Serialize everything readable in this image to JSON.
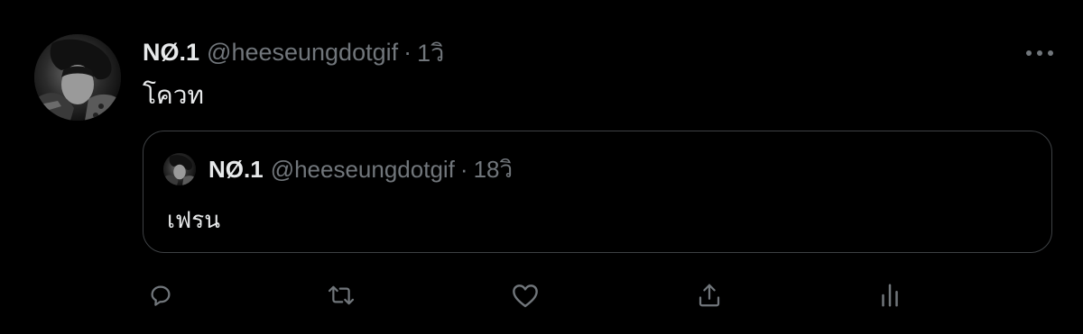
{
  "tweet": {
    "display_name": "NØ.1",
    "handle": "@heeseungdotgif",
    "separator": "·",
    "time": "1วิ",
    "text": "โควท"
  },
  "quoted_tweet": {
    "display_name": "NØ.1",
    "handle": "@heeseungdotgif",
    "separator": "·",
    "time": "18วิ",
    "text": "เฟรน"
  },
  "actions": [
    {
      "name": "reply-icon"
    },
    {
      "name": "retweet-icon"
    },
    {
      "name": "like-icon"
    },
    {
      "name": "share-icon"
    },
    {
      "name": "analytics-icon"
    }
  ],
  "colors": {
    "background": "#000000",
    "primary_text": "#e7e9ea",
    "secondary_text": "#71767b",
    "border": "#3e4144"
  }
}
